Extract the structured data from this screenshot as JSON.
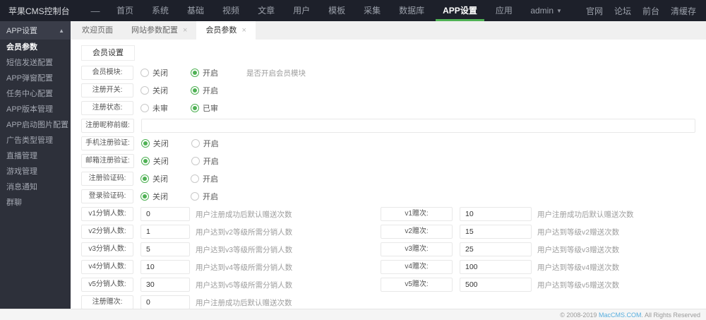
{
  "colors": {
    "accent_green": "#4fb154",
    "link_blue": "#58aede",
    "topbar_bg": "#1d202a",
    "sidebar_bg": "#2d303a"
  },
  "icons": {
    "collapse": "—",
    "caret_down": "▼",
    "caret_up": "▲",
    "close": "×"
  },
  "topbar": {
    "brand": "苹果CMS控制台",
    "nav": [
      "首页",
      "系统",
      "基础",
      "视频",
      "文章",
      "用户",
      "模板",
      "采集",
      "数据库",
      "APP设置",
      "应用"
    ],
    "active_nav": "APP设置",
    "user": "admin",
    "right_links": [
      "官网",
      "论坛",
      "前台",
      "清缓存"
    ]
  },
  "sidebar": {
    "header": "APP设置",
    "active_item": "会员参数",
    "items": [
      "会员参数",
      "短信发送配置",
      "APP弹窗配置",
      "任务中心配置",
      "APP版本管理",
      "APP启动图片配置",
      "广告类型管理",
      "直播管理",
      "游戏管理",
      "消息通知",
      "群聊"
    ]
  },
  "tabs": [
    {
      "label": "欢迎页面",
      "closable": false,
      "active": false
    },
    {
      "label": "网站参数配置",
      "closable": true,
      "active": false
    },
    {
      "label": "会员参数",
      "closable": true,
      "active": true
    }
  ],
  "panel": {
    "tab_label": "会员设置"
  },
  "form": {
    "rows": [
      {
        "type": "radio",
        "label": "会员模块:",
        "options": [
          "关闭",
          "开启"
        ],
        "selected": 1,
        "hint": "是否开启会员模块"
      },
      {
        "type": "radio",
        "label": "注册开关:",
        "options": [
          "关闭",
          "开启"
        ],
        "selected": 1,
        "hint": ""
      },
      {
        "type": "radio",
        "label": "注册状态:",
        "options": [
          "未审",
          "已审"
        ],
        "selected": 1,
        "hint": ""
      },
      {
        "type": "text",
        "label": "注册昵称前缀:",
        "value": "",
        "placeholder": ""
      },
      {
        "type": "radio",
        "label": "手机注册验证:",
        "options": [
          "关闭",
          "开启"
        ],
        "selected": 0,
        "hint": ""
      },
      {
        "type": "radio",
        "label": "邮箱注册验证:",
        "options": [
          "关闭",
          "开启"
        ],
        "selected": 0,
        "hint": ""
      },
      {
        "type": "radio",
        "label": "注册验证码:",
        "options": [
          "关闭",
          "开启"
        ],
        "selected": 0,
        "hint": ""
      },
      {
        "type": "radio",
        "label": "登录验证码:",
        "options": [
          "关闭",
          "开启"
        ],
        "selected": 0,
        "hint": ""
      }
    ],
    "pair_rows": [
      {
        "left": {
          "label": "v1分销人数:",
          "value": "0",
          "hint": "用户注册成功后默认赠送次数"
        },
        "right": {
          "label": "v1赠次:",
          "value": "10",
          "hint": "用户注册成功后默认赠送次数"
        }
      },
      {
        "left": {
          "label": "v2分销人数:",
          "value": "1",
          "hint": "用户达到v2等级所需分销人数"
        },
        "right": {
          "label": "v2赠次:",
          "value": "15",
          "hint": "用户达到等级v2赠送次数"
        }
      },
      {
        "left": {
          "label": "v3分销人数:",
          "value": "5",
          "hint": "用户达到v3等级所需分销人数"
        },
        "right": {
          "label": "v3赠次:",
          "value": "25",
          "hint": "用户达到等级v3赠送次数"
        }
      },
      {
        "left": {
          "label": "v4分销人数:",
          "value": "10",
          "hint": "用户达到v4等级所需分销人数"
        },
        "right": {
          "label": "v4赠次:",
          "value": "100",
          "hint": "用户达到等级v4赠送次数"
        }
      },
      {
        "left": {
          "label": "v5分销人数:",
          "value": "30",
          "hint": "用户达到v5等级所需分销人数"
        },
        "right": {
          "label": "v5赠次:",
          "value": "500",
          "hint": "用户达到等级v5赠送次数"
        }
      },
      {
        "left": {
          "label": "注册赠次:",
          "value": "0",
          "hint": "用户注册成功后默认赠送次数"
        },
        "right": null
      }
    ]
  },
  "footer": {
    "prefix": "© 2008-2019 ",
    "link": "MacCMS.COM",
    "suffix": ". All Rights Reserved"
  }
}
